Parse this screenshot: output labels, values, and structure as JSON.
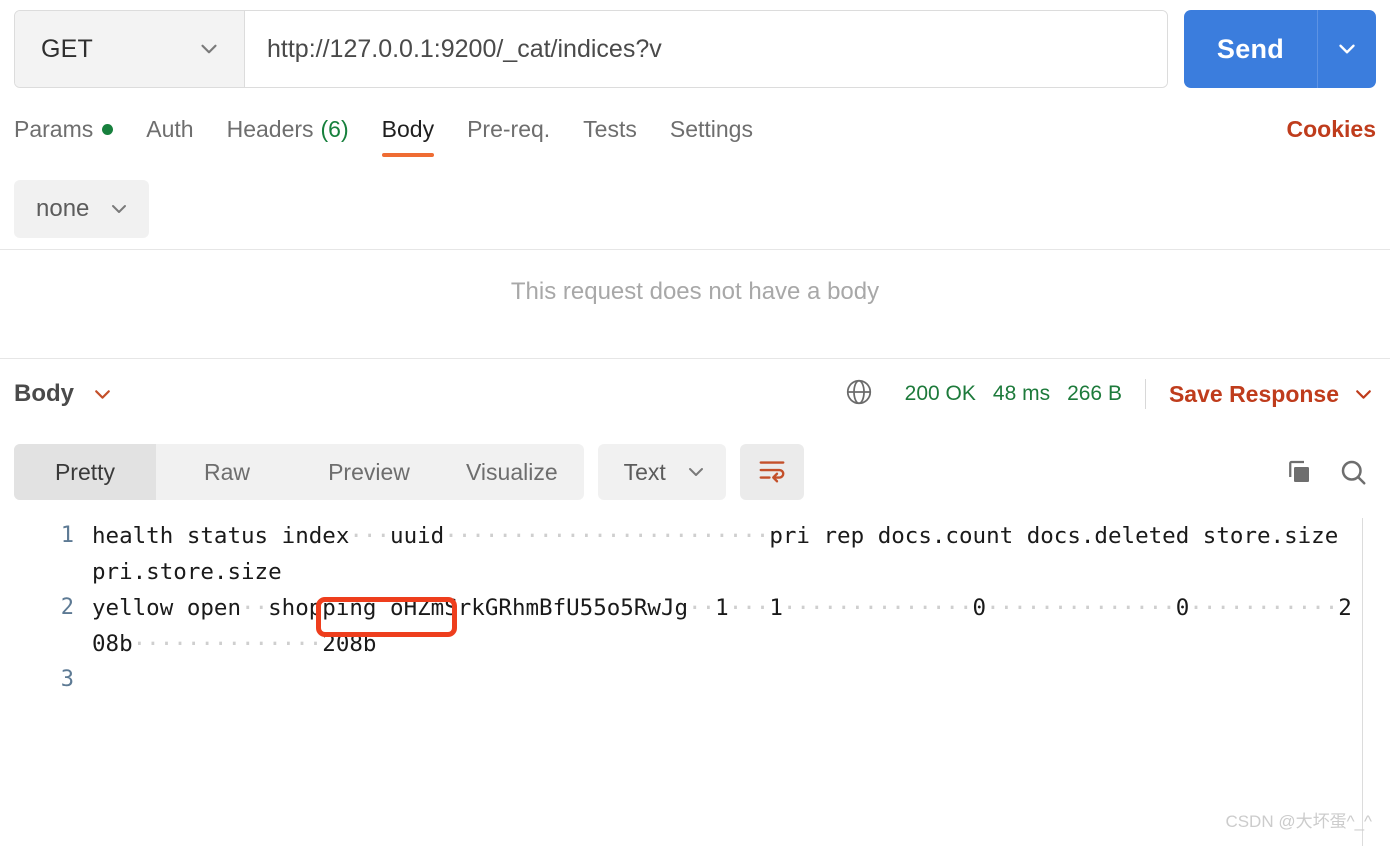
{
  "request": {
    "method": "GET",
    "url": "http://127.0.0.1:9200/_cat/indices?v",
    "send_label": "Send",
    "send_caret_icon": "chevron-down-icon",
    "method_caret_icon": "chevron-down-icon",
    "tabs": [
      {
        "label": "Params",
        "badge": "",
        "dot": true,
        "active": false
      },
      {
        "label": "Auth",
        "badge": "",
        "dot": false,
        "active": false
      },
      {
        "label": "Headers",
        "badge": "(6)",
        "dot": false,
        "active": false
      },
      {
        "label": "Body",
        "badge": "",
        "dot": false,
        "active": true
      },
      {
        "label": "Pre-req.",
        "badge": "",
        "dot": false,
        "active": false
      },
      {
        "label": "Tests",
        "badge": "",
        "dot": false,
        "active": false
      },
      {
        "label": "Settings",
        "badge": "",
        "dot": false,
        "active": false
      }
    ],
    "cookies_label": "Cookies",
    "body_type": "none",
    "body_placeholder": "This request does not have a body"
  },
  "response": {
    "body_label": "Body",
    "globe_icon": "globe-icon",
    "status": "200 OK",
    "time": "48 ms",
    "size": "266 B",
    "save_label": "Save Response",
    "tabs": [
      {
        "label": "Pretty",
        "active": true
      },
      {
        "label": "Raw",
        "active": false
      },
      {
        "label": "Preview",
        "active": false
      },
      {
        "label": "Visualize",
        "active": false
      }
    ],
    "format": "Text",
    "wrap_icon": "word-wrap-icon",
    "copy_icon": "copy-icon",
    "search_icon": "search-icon",
    "lines": [
      {
        "number": "1",
        "segments": [
          {
            "t": "health status index",
            "ws": false
          },
          {
            "t": "···",
            "ws": true
          },
          {
            "t": "uuid",
            "ws": false
          },
          {
            "t": "························",
            "ws": true
          },
          {
            "t": "pri rep docs.count docs.deleted store.size pri.store.size",
            "ws": false
          }
        ]
      },
      {
        "number": "2",
        "segments": [
          {
            "t": "yellow open",
            "ws": false
          },
          {
            "t": "··",
            "ws": true
          },
          {
            "t": "shopping oHZmSrkGRhmBfU55o5RwJg",
            "ws": false
          },
          {
            "t": "··",
            "ws": true
          },
          {
            "t": "1",
            "ws": false
          },
          {
            "t": "···",
            "ws": true
          },
          {
            "t": "1",
            "ws": false
          },
          {
            "t": "··············",
            "ws": true
          },
          {
            "t": "0",
            "ws": false
          },
          {
            "t": "··············",
            "ws": true
          },
          {
            "t": "0",
            "ws": false
          },
          {
            "t": "···········",
            "ws": true
          },
          {
            "t": "208b",
            "ws": false
          },
          {
            "t": "··············",
            "ws": true
          },
          {
            "t": "208b",
            "ws": false
          }
        ]
      },
      {
        "number": "3",
        "segments": []
      }
    ],
    "annotation_target": "shopping"
  },
  "watermark": "CSDN @大坏蛋^_^",
  "colors": {
    "send_blue": "#3b7ddd",
    "accent_orange": "#ef6c33",
    "link_red": "#bf3c1c",
    "status_green": "#1d7a3b",
    "annotation_red": "#ee3e1d"
  }
}
